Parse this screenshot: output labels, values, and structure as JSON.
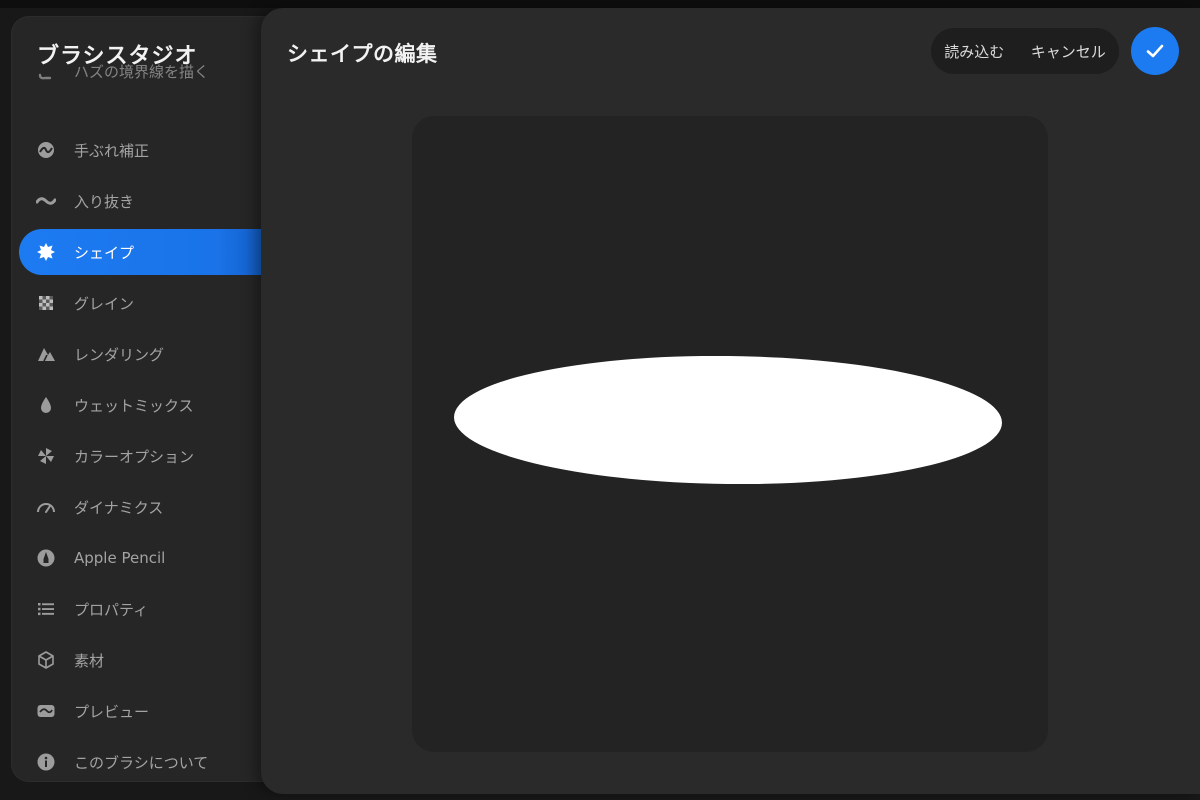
{
  "sidebar": {
    "title": "ブラシスタジオ",
    "items": [
      {
        "label": "ハズの境界線を描く",
        "icon": "stroke-path-icon",
        "active": false,
        "clipped": true
      },
      {
        "label": "手ぶれ補正",
        "icon": "stabilization-icon",
        "active": false
      },
      {
        "label": "入り抜き",
        "icon": "taper-wave-icon",
        "active": false
      },
      {
        "label": "シェイプ",
        "icon": "shape-star-icon",
        "active": true
      },
      {
        "label": "グレイン",
        "icon": "grain-checker-icon",
        "active": false
      },
      {
        "label": "レンダリング",
        "icon": "rendering-icon",
        "active": false
      },
      {
        "label": "ウェットミックス",
        "icon": "drop-icon",
        "active": false
      },
      {
        "label": "カラーオプション",
        "icon": "pinwheel-icon",
        "active": false
      },
      {
        "label": "ダイナミクス",
        "icon": "gauge-icon",
        "active": false
      },
      {
        "label": "Apple Pencil",
        "icon": "pencil-tip-icon",
        "active": false
      },
      {
        "label": "プロパティ",
        "icon": "list-icon",
        "active": false
      },
      {
        "label": "素材",
        "icon": "cube-icon",
        "active": false
      },
      {
        "label": "プレビュー",
        "icon": "preview-icon",
        "active": false
      },
      {
        "label": "このブラシについて",
        "icon": "info-icon",
        "active": false
      }
    ]
  },
  "panel": {
    "title": "シェイプの編集",
    "import_label": "読み込む",
    "cancel_label": "キャンセル",
    "confirm_icon": "checkmark-icon"
  },
  "colors": {
    "accent": "#1c7bf0",
    "panel_bg": "#2a2a2a",
    "sidebar_bg": "#262626",
    "canvas_bg": "#232323",
    "shape_fill": "#ffffff"
  }
}
